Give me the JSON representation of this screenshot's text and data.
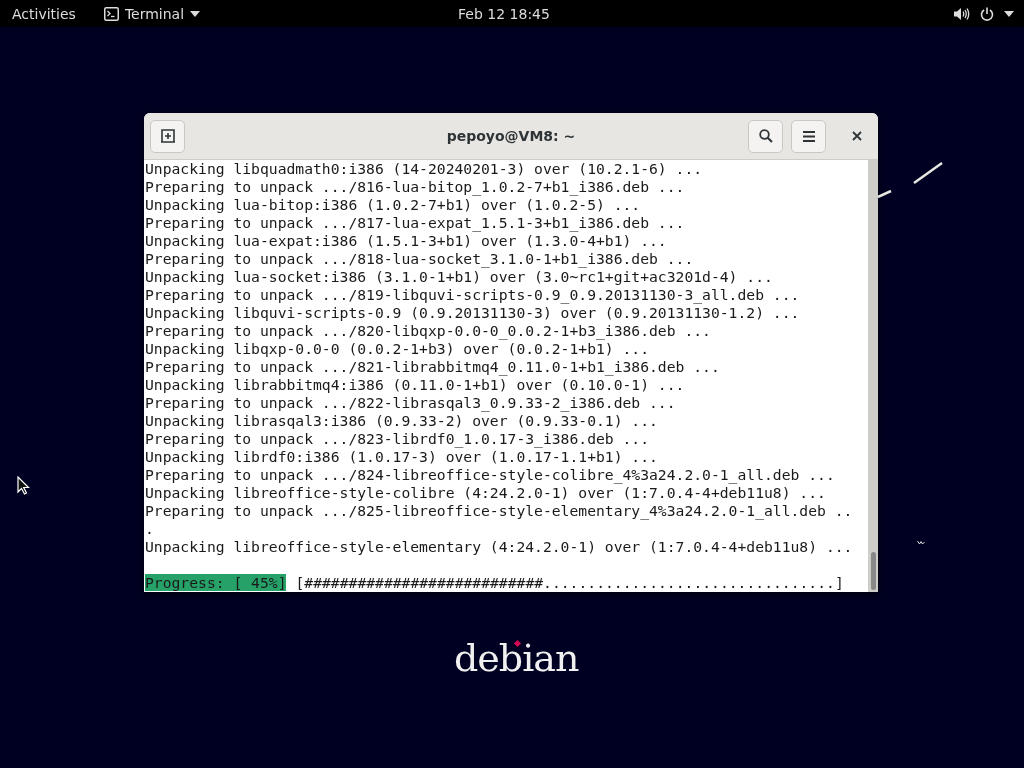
{
  "top_bar": {
    "activities": "Activities",
    "app_menu": "Terminal",
    "clock": "Feb 12  18:45"
  },
  "window": {
    "title": "pepoyo@VM8: ~"
  },
  "terminal": {
    "lines": [
      "Unpacking libquadmath0:i386 (14-20240201-3) over (10.2.1-6) ...",
      "Preparing to unpack .../816-lua-bitop_1.0.2-7+b1_i386.deb ...",
      "Unpacking lua-bitop:i386 (1.0.2-7+b1) over (1.0.2-5) ...",
      "Preparing to unpack .../817-lua-expat_1.5.1-3+b1_i386.deb ...",
      "Unpacking lua-expat:i386 (1.5.1-3+b1) over (1.3.0-4+b1) ...",
      "Preparing to unpack .../818-lua-socket_3.1.0-1+b1_i386.deb ...",
      "Unpacking lua-socket:i386 (3.1.0-1+b1) over (3.0~rc1+git+ac3201d-4) ...",
      "Preparing to unpack .../819-libquvi-scripts-0.9_0.9.20131130-3_all.deb ...",
      "Unpacking libquvi-scripts-0.9 (0.9.20131130-3) over (0.9.20131130-1.2) ...",
      "Preparing to unpack .../820-libqxp-0.0-0_0.0.2-1+b3_i386.deb ...",
      "Unpacking libqxp-0.0-0 (0.0.2-1+b3) over (0.0.2-1+b1) ...",
      "Preparing to unpack .../821-librabbitmq4_0.11.0-1+b1_i386.deb ...",
      "Unpacking librabbitmq4:i386 (0.11.0-1+b1) over (0.10.0-1) ...",
      "Preparing to unpack .../822-librasqal3_0.9.33-2_i386.deb ...",
      "Unpacking librasqal3:i386 (0.9.33-2) over (0.9.33-0.1) ...",
      "Preparing to unpack .../823-librdf0_1.0.17-3_i386.deb ...",
      "Unpacking librdf0:i386 (1.0.17-3) over (1.0.17-1.1+b1) ...",
      "Preparing to unpack .../824-libreoffice-style-colibre_4%3a24.2.0-1_all.deb ...",
      "Unpacking libreoffice-style-colibre (4:24.2.0-1) over (1:7.0.4-4+deb11u8) ...",
      "Preparing to unpack .../825-libreoffice-style-elementary_4%3a24.2.0-1_all.deb ..",
      ".",
      "Unpacking libreoffice-style-elementary (4:24.2.0-1) over (1:7.0.4-4+deb11u8) ..."
    ],
    "progress": {
      "label": "Progress: [ 45%]",
      "bar": "[###########################.................................]"
    }
  },
  "desktop": {
    "logo": "debian"
  }
}
